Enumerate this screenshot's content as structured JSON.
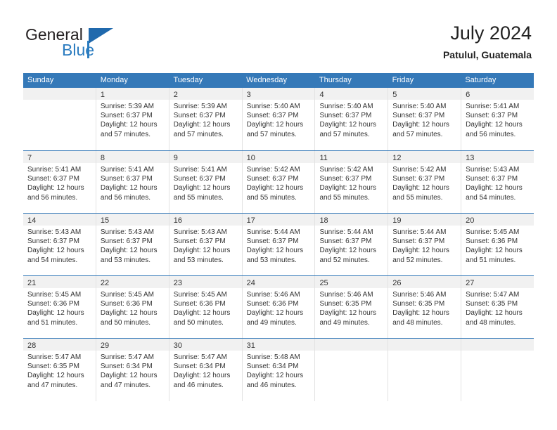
{
  "brand": {
    "name_primary": "General",
    "name_secondary": "Blue",
    "triangle_icon": "triangle-logo-icon"
  },
  "header": {
    "title": "July 2024",
    "subtitle": "Patulul, Guatemala"
  },
  "colors": {
    "header_blue": "#3579b8",
    "daynum_band": "#f1f1f1",
    "logo_blue": "#2b7cc0",
    "text": "#333333"
  },
  "weekday_headers": [
    "Sunday",
    "Monday",
    "Tuesday",
    "Wednesday",
    "Thursday",
    "Friday",
    "Saturday"
  ],
  "weeks": [
    [
      {
        "day": "",
        "lines": []
      },
      {
        "day": "1",
        "lines": [
          "Sunrise: 5:39 AM",
          "Sunset: 6:37 PM",
          "Daylight: 12 hours",
          "and 57 minutes."
        ]
      },
      {
        "day": "2",
        "lines": [
          "Sunrise: 5:39 AM",
          "Sunset: 6:37 PM",
          "Daylight: 12 hours",
          "and 57 minutes."
        ]
      },
      {
        "day": "3",
        "lines": [
          "Sunrise: 5:40 AM",
          "Sunset: 6:37 PM",
          "Daylight: 12 hours",
          "and 57 minutes."
        ]
      },
      {
        "day": "4",
        "lines": [
          "Sunrise: 5:40 AM",
          "Sunset: 6:37 PM",
          "Daylight: 12 hours",
          "and 57 minutes."
        ]
      },
      {
        "day": "5",
        "lines": [
          "Sunrise: 5:40 AM",
          "Sunset: 6:37 PM",
          "Daylight: 12 hours",
          "and 57 minutes."
        ]
      },
      {
        "day": "6",
        "lines": [
          "Sunrise: 5:41 AM",
          "Sunset: 6:37 PM",
          "Daylight: 12 hours",
          "and 56 minutes."
        ]
      }
    ],
    [
      {
        "day": "7",
        "lines": [
          "Sunrise: 5:41 AM",
          "Sunset: 6:37 PM",
          "Daylight: 12 hours",
          "and 56 minutes."
        ]
      },
      {
        "day": "8",
        "lines": [
          "Sunrise: 5:41 AM",
          "Sunset: 6:37 PM",
          "Daylight: 12 hours",
          "and 56 minutes."
        ]
      },
      {
        "day": "9",
        "lines": [
          "Sunrise: 5:41 AM",
          "Sunset: 6:37 PM",
          "Daylight: 12 hours",
          "and 55 minutes."
        ]
      },
      {
        "day": "10",
        "lines": [
          "Sunrise: 5:42 AM",
          "Sunset: 6:37 PM",
          "Daylight: 12 hours",
          "and 55 minutes."
        ]
      },
      {
        "day": "11",
        "lines": [
          "Sunrise: 5:42 AM",
          "Sunset: 6:37 PM",
          "Daylight: 12 hours",
          "and 55 minutes."
        ]
      },
      {
        "day": "12",
        "lines": [
          "Sunrise: 5:42 AM",
          "Sunset: 6:37 PM",
          "Daylight: 12 hours",
          "and 55 minutes."
        ]
      },
      {
        "day": "13",
        "lines": [
          "Sunrise: 5:43 AM",
          "Sunset: 6:37 PM",
          "Daylight: 12 hours",
          "and 54 minutes."
        ]
      }
    ],
    [
      {
        "day": "14",
        "lines": [
          "Sunrise: 5:43 AM",
          "Sunset: 6:37 PM",
          "Daylight: 12 hours",
          "and 54 minutes."
        ]
      },
      {
        "day": "15",
        "lines": [
          "Sunrise: 5:43 AM",
          "Sunset: 6:37 PM",
          "Daylight: 12 hours",
          "and 53 minutes."
        ]
      },
      {
        "day": "16",
        "lines": [
          "Sunrise: 5:43 AM",
          "Sunset: 6:37 PM",
          "Daylight: 12 hours",
          "and 53 minutes."
        ]
      },
      {
        "day": "17",
        "lines": [
          "Sunrise: 5:44 AM",
          "Sunset: 6:37 PM",
          "Daylight: 12 hours",
          "and 53 minutes."
        ]
      },
      {
        "day": "18",
        "lines": [
          "Sunrise: 5:44 AM",
          "Sunset: 6:37 PM",
          "Daylight: 12 hours",
          "and 52 minutes."
        ]
      },
      {
        "day": "19",
        "lines": [
          "Sunrise: 5:44 AM",
          "Sunset: 6:37 PM",
          "Daylight: 12 hours",
          "and 52 minutes."
        ]
      },
      {
        "day": "20",
        "lines": [
          "Sunrise: 5:45 AM",
          "Sunset: 6:36 PM",
          "Daylight: 12 hours",
          "and 51 minutes."
        ]
      }
    ],
    [
      {
        "day": "21",
        "lines": [
          "Sunrise: 5:45 AM",
          "Sunset: 6:36 PM",
          "Daylight: 12 hours",
          "and 51 minutes."
        ]
      },
      {
        "day": "22",
        "lines": [
          "Sunrise: 5:45 AM",
          "Sunset: 6:36 PM",
          "Daylight: 12 hours",
          "and 50 minutes."
        ]
      },
      {
        "day": "23",
        "lines": [
          "Sunrise: 5:45 AM",
          "Sunset: 6:36 PM",
          "Daylight: 12 hours",
          "and 50 minutes."
        ]
      },
      {
        "day": "24",
        "lines": [
          "Sunrise: 5:46 AM",
          "Sunset: 6:36 PM",
          "Daylight: 12 hours",
          "and 49 minutes."
        ]
      },
      {
        "day": "25",
        "lines": [
          "Sunrise: 5:46 AM",
          "Sunset: 6:35 PM",
          "Daylight: 12 hours",
          "and 49 minutes."
        ]
      },
      {
        "day": "26",
        "lines": [
          "Sunrise: 5:46 AM",
          "Sunset: 6:35 PM",
          "Daylight: 12 hours",
          "and 48 minutes."
        ]
      },
      {
        "day": "27",
        "lines": [
          "Sunrise: 5:47 AM",
          "Sunset: 6:35 PM",
          "Daylight: 12 hours",
          "and 48 minutes."
        ]
      }
    ],
    [
      {
        "day": "28",
        "lines": [
          "Sunrise: 5:47 AM",
          "Sunset: 6:35 PM",
          "Daylight: 12 hours",
          "and 47 minutes."
        ]
      },
      {
        "day": "29",
        "lines": [
          "Sunrise: 5:47 AM",
          "Sunset: 6:34 PM",
          "Daylight: 12 hours",
          "and 47 minutes."
        ]
      },
      {
        "day": "30",
        "lines": [
          "Sunrise: 5:47 AM",
          "Sunset: 6:34 PM",
          "Daylight: 12 hours",
          "and 46 minutes."
        ]
      },
      {
        "day": "31",
        "lines": [
          "Sunrise: 5:48 AM",
          "Sunset: 6:34 PM",
          "Daylight: 12 hours",
          "and 46 minutes."
        ]
      },
      {
        "day": "",
        "lines": []
      },
      {
        "day": "",
        "lines": []
      },
      {
        "day": "",
        "lines": []
      }
    ]
  ]
}
